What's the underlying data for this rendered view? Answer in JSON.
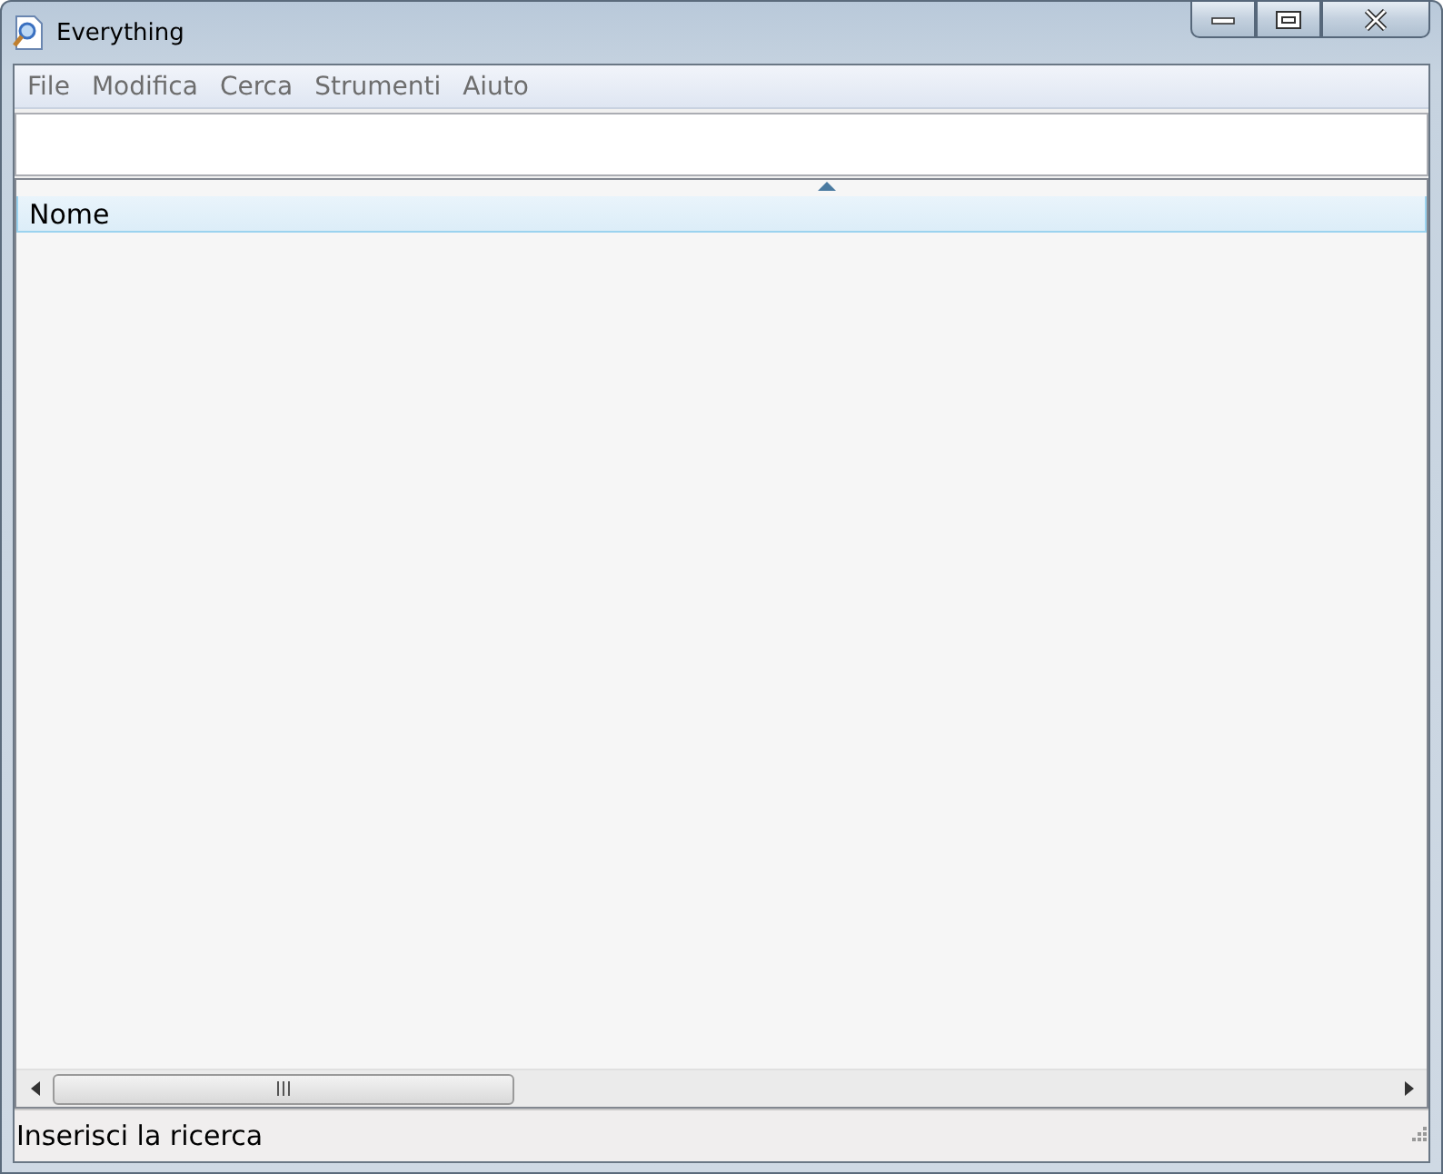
{
  "window": {
    "title": "Everything"
  },
  "menu": [
    "File",
    "Modifica",
    "Cerca",
    "Strumenti",
    "Aiuto"
  ],
  "table": {
    "columns": [
      {
        "label": "Nome",
        "sorted": true
      }
    ]
  },
  "status_bar": "Inserisci la ricerca"
}
